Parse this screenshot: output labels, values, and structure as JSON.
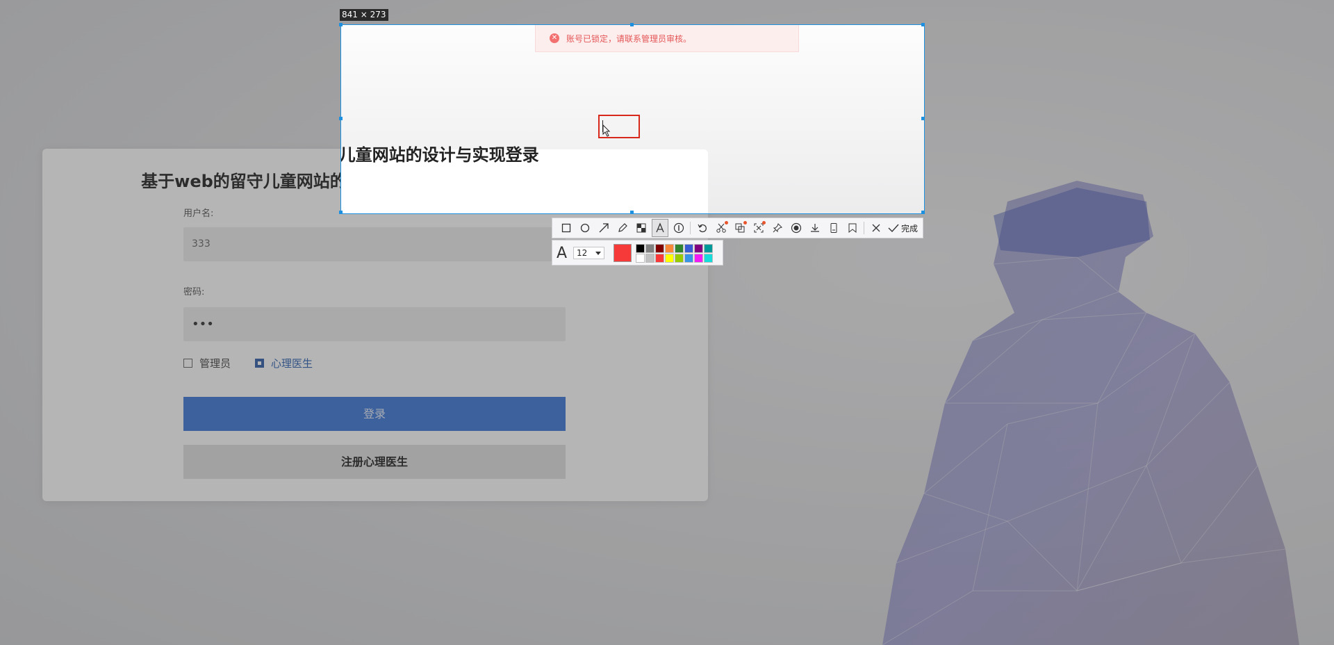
{
  "login": {
    "title": "基于web的留守儿童网站的设计与实现登录",
    "username_label": "用户名:",
    "username_value": "333",
    "password_label": "密码:",
    "password_value": "•••",
    "roles": [
      {
        "label": "管理员",
        "checked": false
      },
      {
        "label": "心理医生",
        "checked": true
      }
    ],
    "login_button": "登录",
    "register_button": "注册心理医生"
  },
  "capture": {
    "size_label": "841 × 273",
    "toast_message": "账号已锁定，请联系管理员审核。",
    "toast_icon": "error-circle-icon",
    "toolbar": {
      "tools": [
        "rectangle-icon",
        "ellipse-icon",
        "arrow-icon",
        "pencil-icon",
        "mosaic-icon",
        "text-icon",
        "serial-number-icon",
        "undo-icon",
        "scissors-icon",
        "ocr-icon",
        "scroll-capture-icon",
        "pin-icon",
        "record-icon",
        "download-icon",
        "long-screenshot-icon",
        "bookmark-icon",
        "close-icon",
        "check-icon"
      ],
      "selected_tool": "text-icon",
      "done_label": "完成"
    },
    "text_options": {
      "font_icon": "font-icon",
      "font_size": "12",
      "current_color": "#f63a3a",
      "palette": [
        "#000000",
        "#808080",
        "#800000",
        "#f7883a",
        "#308430",
        "#385ad3",
        "#800080",
        "#009999",
        "#ffffff",
        "#c0c0c0",
        "#fb3838",
        "#ffff00",
        "#99cc00",
        "#3894e4",
        "#f31bf3",
        "#16dcdc"
      ]
    }
  }
}
